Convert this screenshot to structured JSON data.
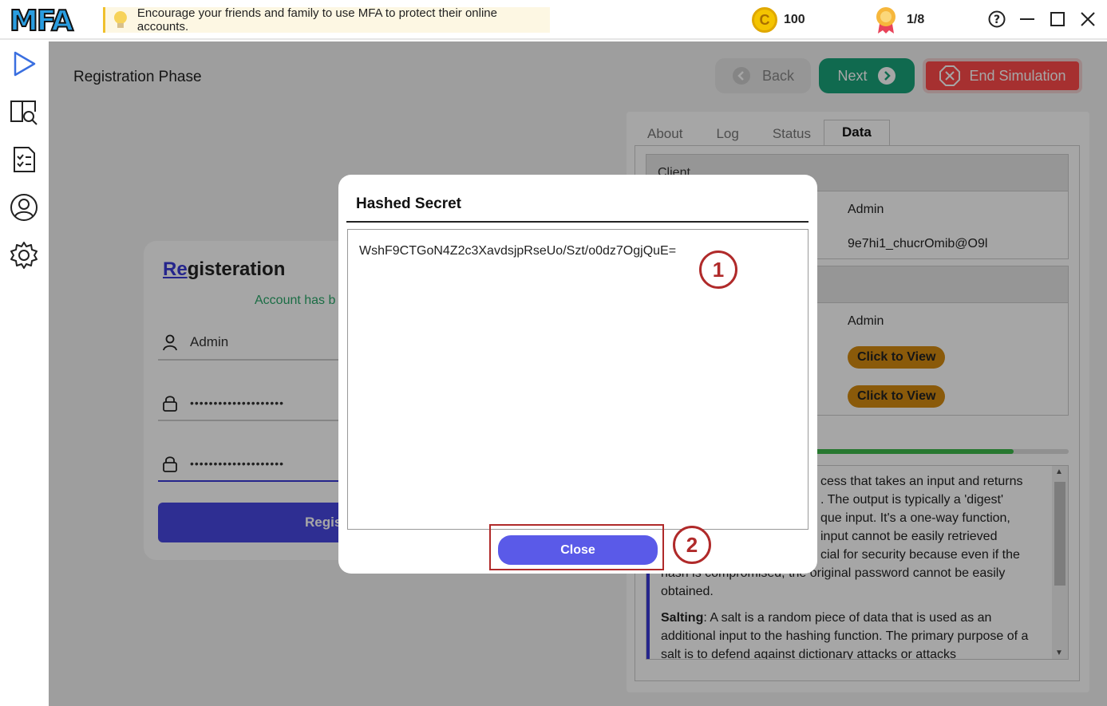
{
  "app": {
    "logo_text": "MFA",
    "tip": "Encourage your friends and family to use MFA to protect their online accounts.",
    "coins": "100",
    "level": "1/8"
  },
  "sidebar": {
    "items": [
      "play-icon",
      "search-book-icon",
      "checklist-icon",
      "user-icon",
      "settings-icon"
    ]
  },
  "main": {
    "phase_title": "Registration Phase",
    "back_label": "Back",
    "next_label": "Next",
    "end_label": "End Simulation"
  },
  "registration": {
    "title_highlight": "Re",
    "title_rest": "gisteration",
    "message": "Account has b",
    "username": "Admin",
    "password_dots": "••••••••••••••••••••",
    "confirm_dots": "••••••••••••••••••••",
    "button_label": "Regist"
  },
  "panel": {
    "tabs": [
      "About",
      "Log",
      "Status",
      "Data"
    ],
    "active_tab": "Data",
    "client_section": "Client",
    "client_user": "Admin",
    "client_password": "9e7hi1_chucrOmib@O9l",
    "server_user": "Admin",
    "view1": "Click to View",
    "view2": "Click to View",
    "progress": 0.87,
    "info_p1": "Hashing: Hashing is a process that takes an input and returns a fixed-size string of bytes. The output is typically a 'digest' that is unique to each unique input. It's a one-way function, meaning that the original input cannot be easily retrieved from the output. This is crucial for security because even if the hash is compromised, the original password cannot be easily obtained.",
    "info_p1_visible_a": "cess that takes an input and returns",
    "info_p1_visible_b": ". The output is typically a 'digest'",
    "info_p1_visible_c": "que input. It's a one-way function,",
    "info_p1_visible_d": "input cannot be easily retrieved",
    "info_p1_visible_e": "cial for security because even if the",
    "info_p1_visible_f": "hash is compromised, the original password cannot be easily",
    "info_p1_visible_g": "obtained.",
    "info_p2_label": "Salting",
    "info_p2_text": ": A salt is a random piece of data that is used as an additional input to the hashing function. The primary purpose of a salt is to defend against dictionary attacks or attacks"
  },
  "modal": {
    "title": "Hashed Secret",
    "value": "WshF9CTGoN4Z2c3XavdsjpRseUo/Szt/o0dz7OgjQuE=",
    "close_label": "Close",
    "callout1": "1",
    "callout2": "2"
  },
  "colors": {
    "accent": "#5a5ae8",
    "next": "#1aa37a",
    "end": "#ff4a4a",
    "callout": "#b02a2a"
  }
}
